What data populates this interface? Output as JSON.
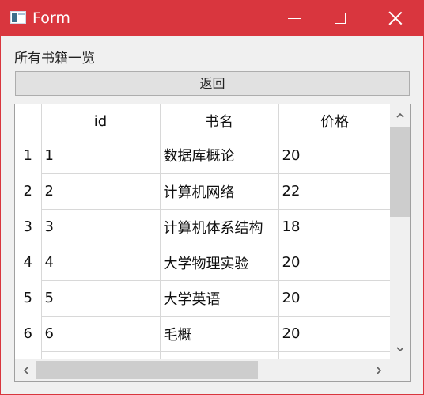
{
  "window": {
    "title": "Form",
    "accent": "#d9363e"
  },
  "heading": "所有书籍一览",
  "back_button": "返回",
  "table": {
    "columns": [
      "id",
      "书名",
      "价格"
    ],
    "rows": [
      {
        "num": "1",
        "id": "1",
        "name": "数据库概论",
        "price": "20"
      },
      {
        "num": "2",
        "id": "2",
        "name": "计算机网络",
        "price": "22"
      },
      {
        "num": "3",
        "id": "3",
        "name": "计算机体系结构",
        "price": "18"
      },
      {
        "num": "4",
        "id": "4",
        "name": "大学物理实验",
        "price": "20"
      },
      {
        "num": "5",
        "id": "5",
        "name": "大学英语",
        "price": "20"
      },
      {
        "num": "6",
        "id": "6",
        "name": "毛概",
        "price": "20"
      }
    ]
  }
}
